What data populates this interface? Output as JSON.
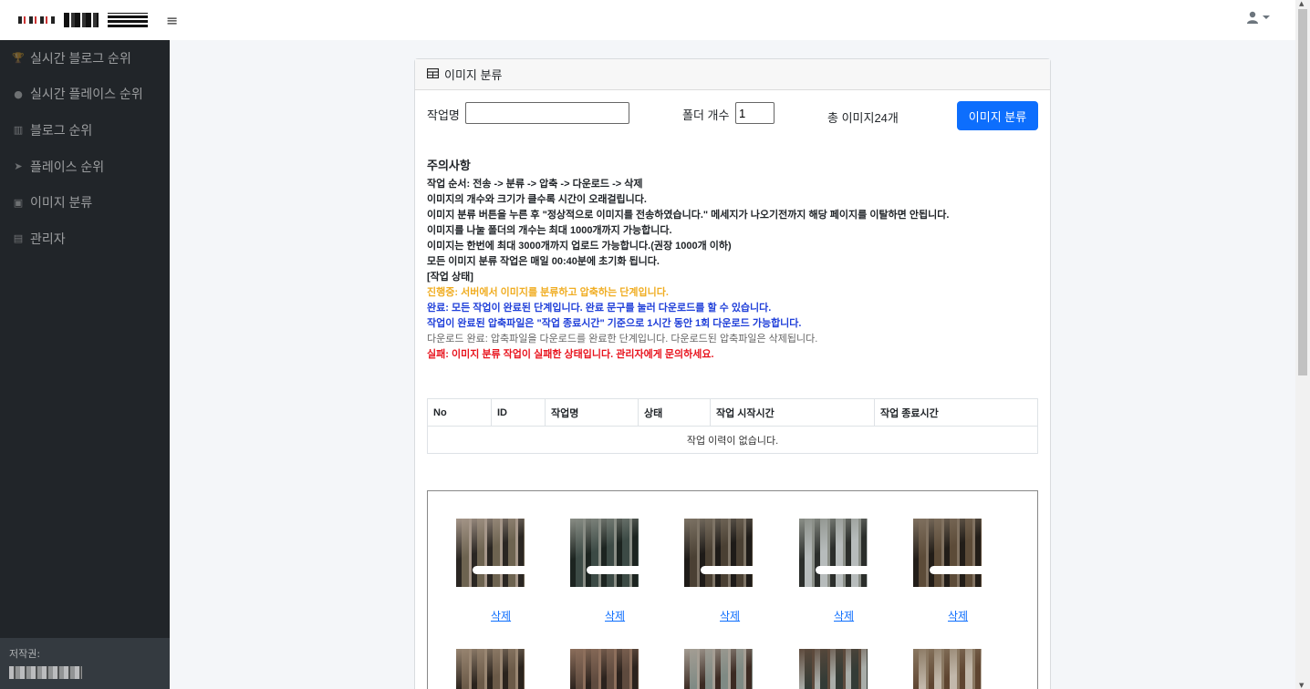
{
  "topbar": {
    "menu_icon": "hamburger-icon",
    "user_icon": "user-icon"
  },
  "sidebar": {
    "items": [
      {
        "label": "실시간 블로그 순위",
        "icon": "trophy-icon"
      },
      {
        "label": "실시간 플레이스 순위",
        "icon": "compass-icon"
      },
      {
        "label": "블로그 순위",
        "icon": "columns-icon"
      },
      {
        "label": "플레이스 순위",
        "icon": "location-arrow-icon"
      },
      {
        "label": "이미지 분류",
        "icon": "images-icon"
      },
      {
        "label": "관리자",
        "icon": "id-card-icon"
      }
    ],
    "footer_label": "저작권:"
  },
  "card": {
    "title": "이미지 분류",
    "title_icon": "table-icon",
    "job_name_label": "작업명",
    "job_name_value": "",
    "folder_count_label": "폴더 개수",
    "folder_count_value": "1",
    "total_images": "총 이미지24개",
    "classify_button": "이미지 분류"
  },
  "notes": {
    "title": "주의사항",
    "lines": [
      "작업 순서: 전송 -> 분류 -> 압축 -> 다운로드 -> 삭제",
      "이미지의 개수와 크기가 클수록 시간이 오래걸립니다.",
      "이미지 분류 버튼을 누른 후 \"정상적으로 이미지를 전송하였습니다.\" 메세지가 나오기전까지 해당 페이지를 이탈하면 안됩니다.",
      "이미지를 나눌 폴더의 개수는 최대 1000개까지 가능합니다.",
      "이미지는 한번에 최대 3000개까지 업로드 가능합니다.(권장 1000개 이하)",
      "모든 이미지 분류 작업은 매일 00:40분에 초기화 됩니다.",
      "[작업 상태]"
    ],
    "status_lines": [
      {
        "text": "진행중: 서버에서 이미지를 분류하고 압축하는 단계입니다.",
        "color": "#f0ad22"
      },
      {
        "text": "완료: 모든 작업이 완료된 단계입니다. 완료 문구를 눌러 다운로드를 할 수 있습니다.",
        "color": "#1f3fd9"
      },
      {
        "text": "작업이 완료된 압축파일은 \"작업 종료시간\" 기준으로 1시간 동안 1회 다운로드 가능합니다.",
        "color": "#1f3fd9"
      },
      {
        "text": "다운로드 완료: 압축파일을 다운로드를 완료한 단계입니다. 다운로드된 압축파일은 삭제됩니다.",
        "color": "#666666"
      },
      {
        "text": "실패: 이미지 분류 작업이 실패한 상태입니다. 관리자에게 문의하세요.",
        "color": "#e8141e"
      }
    ]
  },
  "table": {
    "headers": [
      "No",
      "ID",
      "작업명",
      "상태",
      "작업 시작시간",
      "작업 종료시간"
    ],
    "empty_message": "작업 이력이 없습니다."
  },
  "gallery": {
    "delete_label": "삭제",
    "row1": [
      {
        "colors": [
          "#6d6350",
          "#2a2622",
          "#a6978a"
        ]
      },
      {
        "colors": [
          "#3c4a45",
          "#1c2420",
          "#8a8e86"
        ]
      },
      {
        "colors": [
          "#4a4033",
          "#1e1b18",
          "#7e7466"
        ]
      },
      {
        "colors": [
          "#b7bcbc",
          "#2b2e2b",
          "#8b8f88"
        ]
      },
      {
        "colors": [
          "#5c4b38",
          "#221d18",
          "#817261"
        ]
      }
    ],
    "row2": [
      {
        "colors": [
          "#6b5a48",
          "#2a231d",
          "#998672"
        ]
      },
      {
        "colors": [
          "#5e4a3e",
          "#2b221d",
          "#8d6f5c"
        ]
      },
      {
        "colors": [
          "#7f8a84",
          "#3b2a22",
          "#a59e94"
        ]
      },
      {
        "colors": [
          "#333b36",
          "#a9ada9",
          "#5d4a3c"
        ]
      },
      {
        "colors": [
          "#c2b8ab",
          "#5e4430",
          "#8a7862"
        ]
      }
    ]
  }
}
